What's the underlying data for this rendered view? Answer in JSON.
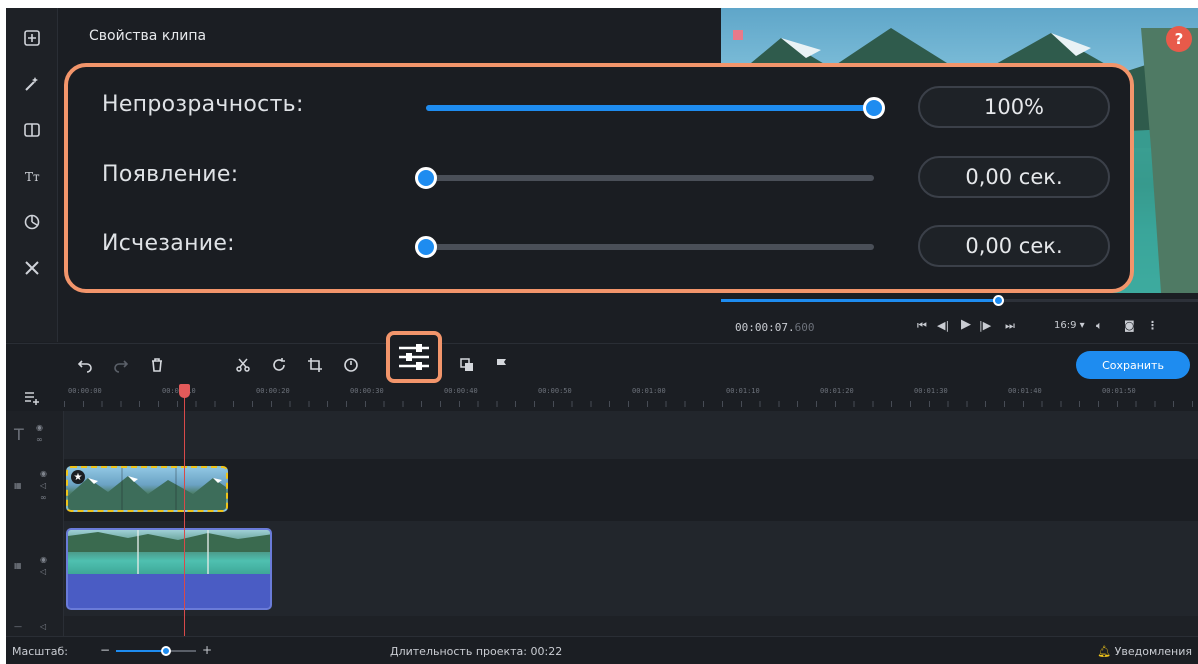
{
  "properties": {
    "title": "Свойства клипа",
    "rows": [
      {
        "label": "Непрозрачность:",
        "value": "100%",
        "level": 1.0
      },
      {
        "label": "Появление:",
        "value": "0,00 сек.",
        "level": 0.0
      },
      {
        "label": "Исчезание:",
        "value": "0,00 сек.",
        "level": 0.0
      }
    ]
  },
  "player": {
    "timecode_main": "00:00:07.",
    "timecode_ms": "600",
    "aspect_ratio": "16:9 ▾",
    "progress": 0.58
  },
  "toolbar": {
    "save_label": "Сохранить"
  },
  "ruler": {
    "ticks": [
      "00:00:00",
      "00:00:10",
      "00:00:20",
      "00:00:30",
      "00:00:40",
      "00:00:50",
      "00:01:00",
      "00:01:10",
      "00:01:20",
      "00:01:30",
      "00:01:40",
      "00:01:50"
    ]
  },
  "status": {
    "zoom_label": "Масштаб:",
    "zoom_level": 0.62,
    "duration": "Длительность проекта: 00:22",
    "notifications": "Уведомления"
  },
  "colors": {
    "accent": "#1e8cf0",
    "highlight": "#f2956b",
    "playhead": "#e25a5a",
    "overlay_clip_border": "#f0c419",
    "audio_clip": "#4a5cc4"
  }
}
